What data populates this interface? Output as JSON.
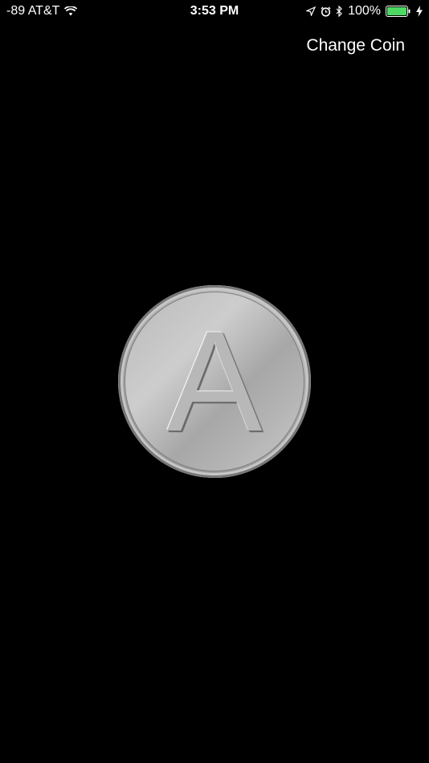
{
  "status_bar": {
    "carrier": "-89 AT&T",
    "time": "3:53 PM",
    "battery": "100%",
    "icons": [
      "wifi-icon",
      "location-icon",
      "alarm-icon",
      "bluetooth-icon",
      "battery-icon",
      "charging-icon"
    ],
    "battery_color": "#4cd964"
  },
  "nav": {
    "change_coin_label": "Change Coin"
  },
  "coin": {
    "letter": "A",
    "color": "#b8b8b8"
  }
}
